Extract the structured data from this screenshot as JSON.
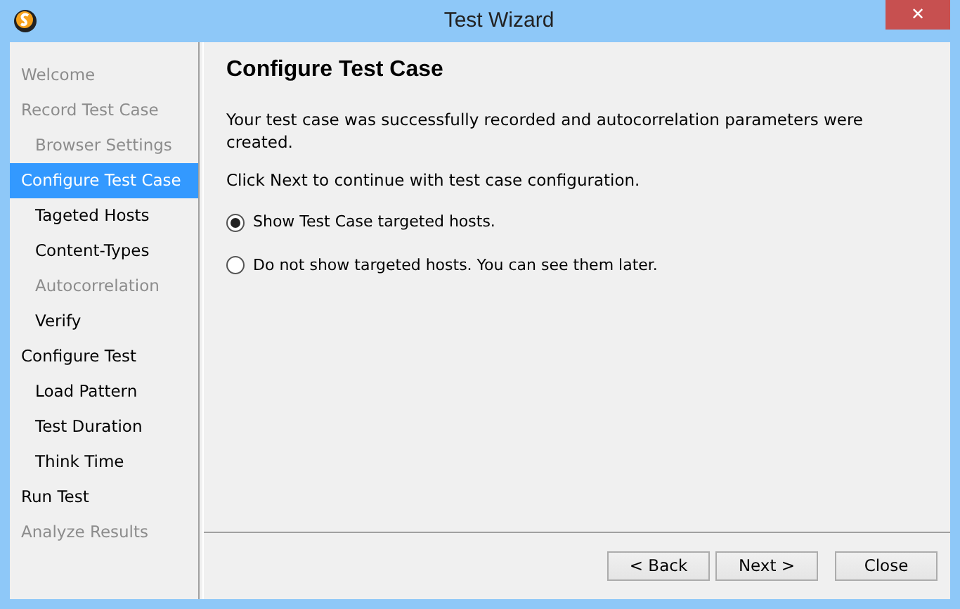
{
  "window": {
    "title": "Test Wizard",
    "close_glyph": "✕"
  },
  "steps": [
    {
      "label": "Welcome",
      "selected": false,
      "disabled": true
    },
    {
      "label": "Record Test Case",
      "selected": false,
      "disabled": true,
      "children": [
        {
          "label": "Browser Settings",
          "selected": false,
          "disabled": true
        }
      ]
    },
    {
      "label": "Configure Test Case",
      "selected": true,
      "disabled": false,
      "children": [
        {
          "label": "Tageted Hosts",
          "selected": false,
          "disabled": false
        },
        {
          "label": "Content-Types",
          "selected": false,
          "disabled": false
        },
        {
          "label": "Autocorrelation",
          "selected": false,
          "disabled": true
        },
        {
          "label": "Verify",
          "selected": false,
          "disabled": false
        }
      ]
    },
    {
      "label": "Configure Test",
      "selected": false,
      "disabled": false,
      "children": [
        {
          "label": "Load Pattern",
          "selected": false,
          "disabled": false
        },
        {
          "label": "Test Duration",
          "selected": false,
          "disabled": false
        },
        {
          "label": "Think Time",
          "selected": false,
          "disabled": false
        }
      ]
    },
    {
      "label": "Run Test",
      "selected": false,
      "disabled": false
    },
    {
      "label": "Analyze Results",
      "selected": false,
      "disabled": true
    }
  ],
  "page": {
    "heading": "Configure Test Case",
    "paragraphs": [
      "Your test case was successfully recorded and autocorrelation parameters were created.",
      "Click Next to continue with test case configuration."
    ],
    "options": [
      {
        "label": "Show Test Case targeted hosts.",
        "selected": true
      },
      {
        "label": "Do not show targeted hosts. You can see them later.",
        "selected": false
      }
    ]
  },
  "buttons": [
    {
      "label": "< Back"
    },
    {
      "label": "Next >"
    },
    {
      "label": "Close"
    }
  ]
}
